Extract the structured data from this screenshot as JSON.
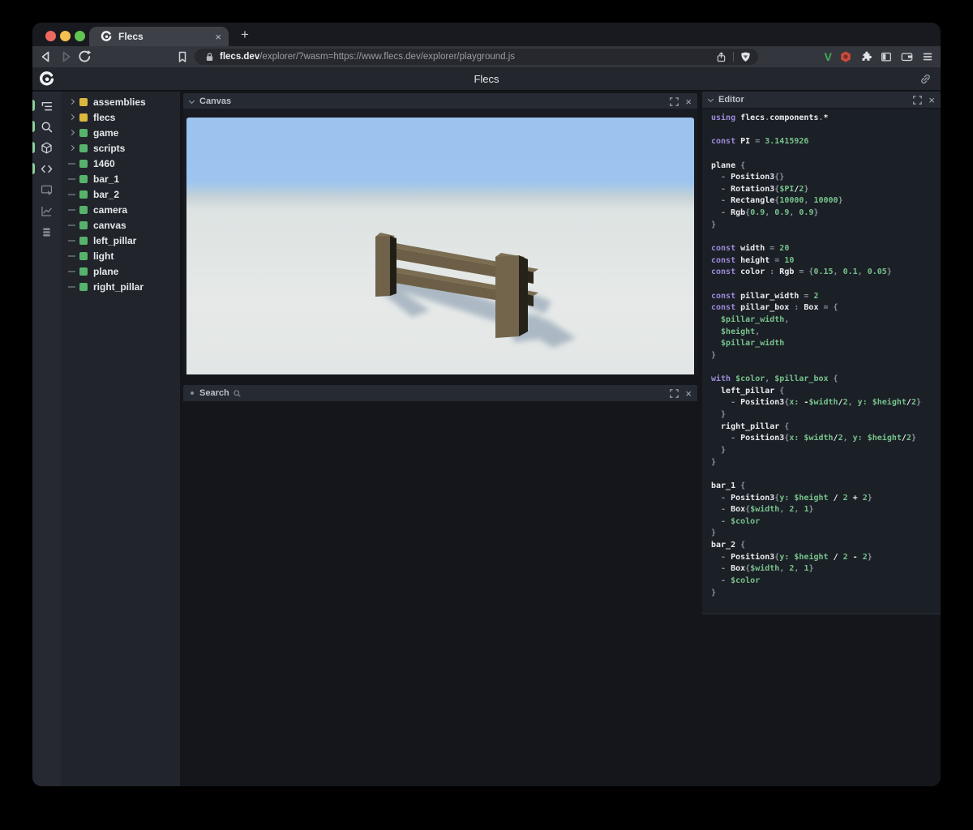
{
  "browser": {
    "tab_title": "Flecs",
    "close_glyph": "×",
    "new_tab_glyph": "+",
    "url_domain": "flecs.dev",
    "url_rest": "/explorer/?wasm=https://www.flecs.dev/explorer/playground.js",
    "traffic_lights": [
      "#ee6a5f",
      "#f5c04f",
      "#61c554"
    ],
    "extension_v_label": "V"
  },
  "app": {
    "header_title": "Flecs"
  },
  "panels": {
    "canvas": {
      "title": "Canvas"
    },
    "search": {
      "title": "Search"
    },
    "editor": {
      "title": "Editor"
    }
  },
  "sidebar_icons": [
    {
      "name": "tree-view",
      "active": true
    },
    {
      "name": "search",
      "active": true
    },
    {
      "name": "entities-cube",
      "active": true
    },
    {
      "name": "code",
      "active": true
    },
    {
      "name": "canvas-screen",
      "active": false
    },
    {
      "name": "stats-chart",
      "active": false
    },
    {
      "name": "queries-stack",
      "active": false
    }
  ],
  "tree": {
    "items": [
      {
        "label": "assemblies",
        "expandable": true,
        "square": "#dcb73f"
      },
      {
        "label": "flecs",
        "expandable": true,
        "square": "#dcb73f"
      },
      {
        "label": "game",
        "expandable": true,
        "square": "#57b26b"
      },
      {
        "label": "scripts",
        "expandable": true,
        "square": "#57b26b"
      },
      {
        "label": "1460",
        "expandable": false,
        "square": "#57b26b"
      },
      {
        "label": "bar_1",
        "expandable": false,
        "square": "#57b26b"
      },
      {
        "label": "bar_2",
        "expandable": false,
        "square": "#57b26b"
      },
      {
        "label": "camera",
        "expandable": false,
        "square": "#57b26b"
      },
      {
        "label": "canvas",
        "expandable": false,
        "square": "#57b26b"
      },
      {
        "label": "left_pillar",
        "expandable": false,
        "square": "#57b26b"
      },
      {
        "label": "light",
        "expandable": false,
        "square": "#57b26b"
      },
      {
        "label": "plane",
        "expandable": false,
        "square": "#57b26b"
      },
      {
        "label": "right_pillar",
        "expandable": false,
        "square": "#57b26b"
      }
    ]
  },
  "code": {
    "token_colors": {
      "k": "#9b8bd9",
      "i": "#e9ebee",
      "v": "#77c28c",
      "p": "#8b919b"
    },
    "lines": [
      [
        [
          "k",
          "using "
        ],
        [
          "i",
          "flecs"
        ],
        [
          "p",
          "."
        ],
        [
          "i",
          "components"
        ],
        [
          "p",
          "."
        ],
        [
          "i",
          "*"
        ]
      ],
      [],
      [
        [
          "k",
          "const "
        ],
        [
          "i",
          "PI"
        ],
        [
          "p",
          " = "
        ],
        [
          "v",
          "3.1415926"
        ]
      ],
      [],
      [
        [
          "i",
          "plane"
        ],
        [
          "p",
          " {"
        ]
      ],
      [
        [
          "p",
          "  - "
        ],
        [
          "i",
          "Position3"
        ],
        [
          "p",
          "{}"
        ]
      ],
      [
        [
          "p",
          "  - "
        ],
        [
          "i",
          "Rotation3"
        ],
        [
          "p",
          "{"
        ],
        [
          "v",
          "$PI"
        ],
        [
          "i",
          "/"
        ],
        [
          "v",
          "2"
        ],
        [
          "p",
          "}"
        ]
      ],
      [
        [
          "p",
          "  - "
        ],
        [
          "i",
          "Rectangle"
        ],
        [
          "p",
          "{"
        ],
        [
          "v",
          "10000"
        ],
        [
          "p",
          ", "
        ],
        [
          "v",
          "10000"
        ],
        [
          "p",
          "}"
        ]
      ],
      [
        [
          "p",
          "  - "
        ],
        [
          "i",
          "Rgb"
        ],
        [
          "p",
          "{"
        ],
        [
          "v",
          "0.9"
        ],
        [
          "p",
          ", "
        ],
        [
          "v",
          "0.9"
        ],
        [
          "p",
          ", "
        ],
        [
          "v",
          "0.9"
        ],
        [
          "p",
          "}"
        ]
      ],
      [
        [
          "p",
          "}"
        ]
      ],
      [],
      [
        [
          "k",
          "const "
        ],
        [
          "i",
          "width"
        ],
        [
          "p",
          " = "
        ],
        [
          "v",
          "20"
        ]
      ],
      [
        [
          "k",
          "const "
        ],
        [
          "i",
          "height"
        ],
        [
          "p",
          " = "
        ],
        [
          "v",
          "10"
        ]
      ],
      [
        [
          "k",
          "const "
        ],
        [
          "i",
          "color"
        ],
        [
          "p",
          " : "
        ],
        [
          "i",
          "Rgb"
        ],
        [
          "p",
          " = {"
        ],
        [
          "v",
          "0.15"
        ],
        [
          "p",
          ", "
        ],
        [
          "v",
          "0.1"
        ],
        [
          "p",
          ", "
        ],
        [
          "v",
          "0.05"
        ],
        [
          "p",
          "}"
        ]
      ],
      [],
      [
        [
          "k",
          "const "
        ],
        [
          "i",
          "pillar_width"
        ],
        [
          "p",
          " = "
        ],
        [
          "v",
          "2"
        ]
      ],
      [
        [
          "k",
          "const "
        ],
        [
          "i",
          "pillar_box"
        ],
        [
          "p",
          " : "
        ],
        [
          "i",
          "Box"
        ],
        [
          "p",
          " = {"
        ]
      ],
      [
        [
          "v",
          "  $pillar_width"
        ],
        [
          "p",
          ","
        ]
      ],
      [
        [
          "v",
          "  $height"
        ],
        [
          "p",
          ","
        ]
      ],
      [
        [
          "v",
          "  $pillar_width"
        ]
      ],
      [
        [
          "p",
          "}"
        ]
      ],
      [],
      [
        [
          "k",
          "with "
        ],
        [
          "v",
          "$color"
        ],
        [
          "p",
          ", "
        ],
        [
          "v",
          "$pillar_box"
        ],
        [
          "p",
          " {"
        ]
      ],
      [
        [
          "i",
          "  left_pillar"
        ],
        [
          "p",
          " {"
        ]
      ],
      [
        [
          "p",
          "    - "
        ],
        [
          "i",
          "Position3"
        ],
        [
          "p",
          "{"
        ],
        [
          "v",
          "x:"
        ],
        [
          "i",
          " -"
        ],
        [
          "v",
          "$width"
        ],
        [
          "i",
          "/"
        ],
        [
          "v",
          "2"
        ],
        [
          "p",
          ", "
        ],
        [
          "v",
          "y:"
        ],
        [
          "p",
          " "
        ],
        [
          "v",
          "$height"
        ],
        [
          "i",
          "/"
        ],
        [
          "v",
          "2"
        ],
        [
          "p",
          "}"
        ]
      ],
      [
        [
          "p",
          "  }"
        ]
      ],
      [
        [
          "i",
          "  right_pillar"
        ],
        [
          "p",
          " {"
        ]
      ],
      [
        [
          "p",
          "    - "
        ],
        [
          "i",
          "Position3"
        ],
        [
          "p",
          "{"
        ],
        [
          "v",
          "x:"
        ],
        [
          "p",
          " "
        ],
        [
          "v",
          "$width"
        ],
        [
          "i",
          "/"
        ],
        [
          "v",
          "2"
        ],
        [
          "p",
          ", "
        ],
        [
          "v",
          "y:"
        ],
        [
          "p",
          " "
        ],
        [
          "v",
          "$height"
        ],
        [
          "i",
          "/"
        ],
        [
          "v",
          "2"
        ],
        [
          "p",
          "}"
        ]
      ],
      [
        [
          "p",
          "  }"
        ]
      ],
      [
        [
          "p",
          "}"
        ]
      ],
      [],
      [
        [
          "i",
          "bar_1"
        ],
        [
          "p",
          " {"
        ]
      ],
      [
        [
          "p",
          "  - "
        ],
        [
          "i",
          "Position3"
        ],
        [
          "p",
          "{"
        ],
        [
          "v",
          "y:"
        ],
        [
          "p",
          " "
        ],
        [
          "v",
          "$height"
        ],
        [
          "i",
          " / "
        ],
        [
          "v",
          "2"
        ],
        [
          "i",
          " + "
        ],
        [
          "v",
          "2"
        ],
        [
          "p",
          "}"
        ]
      ],
      [
        [
          "p",
          "  - "
        ],
        [
          "i",
          "Box"
        ],
        [
          "p",
          "{"
        ],
        [
          "v",
          "$width"
        ],
        [
          "p",
          ", "
        ],
        [
          "v",
          "2"
        ],
        [
          "p",
          ", "
        ],
        [
          "v",
          "1"
        ],
        [
          "p",
          "}"
        ]
      ],
      [
        [
          "p",
          "  - "
        ],
        [
          "v",
          "$color"
        ]
      ],
      [
        [
          "p",
          "}"
        ]
      ],
      [
        [
          "i",
          "bar_2"
        ],
        [
          "p",
          " {"
        ]
      ],
      [
        [
          "p",
          "  - "
        ],
        [
          "i",
          "Position3"
        ],
        [
          "p",
          "{"
        ],
        [
          "v",
          "y:"
        ],
        [
          "p",
          " "
        ],
        [
          "v",
          "$height"
        ],
        [
          "i",
          " / "
        ],
        [
          "v",
          "2"
        ],
        [
          "i",
          " - "
        ],
        [
          "v",
          "2"
        ],
        [
          "p",
          "}"
        ]
      ],
      [
        [
          "p",
          "  - "
        ],
        [
          "i",
          "Box"
        ],
        [
          "p",
          "{"
        ],
        [
          "v",
          "$width"
        ],
        [
          "p",
          ", "
        ],
        [
          "v",
          "2"
        ],
        [
          "p",
          ", "
        ],
        [
          "v",
          "1"
        ],
        [
          "p",
          "}"
        ]
      ],
      [
        [
          "p",
          "  - "
        ],
        [
          "v",
          "$color"
        ]
      ],
      [
        [
          "p",
          "}"
        ]
      ]
    ]
  },
  "scene_colors": {
    "sky": "#9cc2ee",
    "ground": "#e3e7e6",
    "wood_front": "#6d5f47",
    "wood_top": "#7b6d52",
    "wood_side_dark": "#221f17",
    "shadow": "#7e93a8"
  }
}
